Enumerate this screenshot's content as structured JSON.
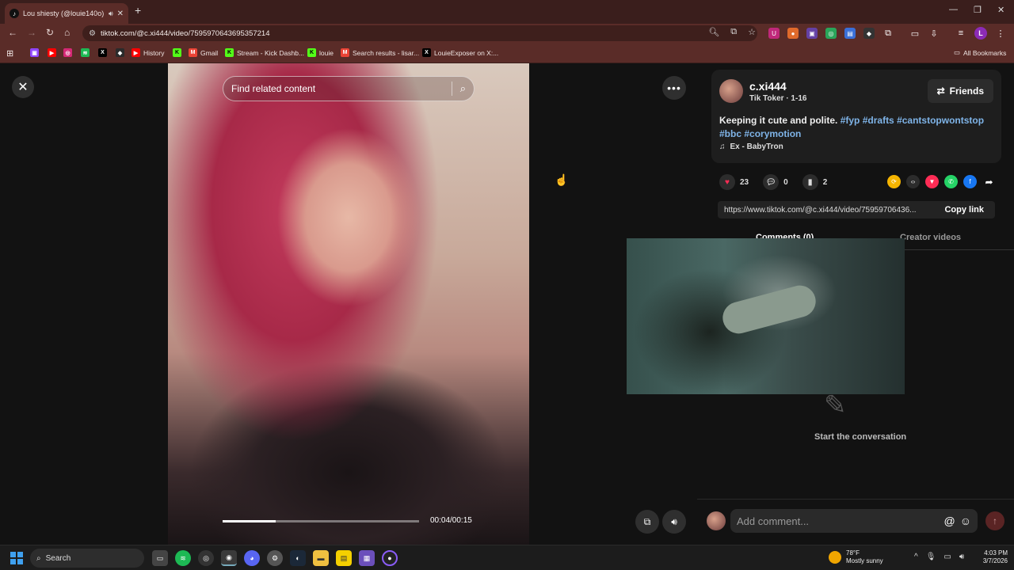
{
  "browser": {
    "tab_title": "Lou shiesty (@louie140o) |",
    "url": "tiktok.com/@c.xi444/video/7595970643695357214",
    "bookmarks": [
      {
        "label": "",
        "icon": "twitch-icon",
        "color": "#9146ff"
      },
      {
        "label": "",
        "icon": "youtube-icon",
        "color": "#ff0000"
      },
      {
        "label": "",
        "icon": "instagram-icon",
        "color": "#d62976"
      },
      {
        "label": "",
        "icon": "spotify-icon",
        "color": "#1db954"
      },
      {
        "label": "",
        "icon": "x-icon",
        "color": "#000000"
      },
      {
        "label": "",
        "icon": "app-icon",
        "color": "#2b2b2b"
      },
      {
        "label": "History",
        "icon": "youtube-icon",
        "color": "#ff0000"
      },
      {
        "label": "",
        "icon": "kick-icon",
        "color": "#53fc18"
      },
      {
        "label": "Gmail",
        "icon": "gmail-icon",
        "color": "#ea4335"
      },
      {
        "label": "Stream - Kick Dashb...",
        "icon": "kick-icon",
        "color": "#53fc18"
      },
      {
        "label": "louie",
        "icon": "kick-icon",
        "color": "#53fc18"
      },
      {
        "label": "Search results - lisar...",
        "icon": "gmail-icon",
        "color": "#ea4335"
      },
      {
        "label": "LouieExposer on X:...",
        "icon": "x-icon",
        "color": "#000000"
      }
    ],
    "all_bookmarks": "All Bookmarks"
  },
  "video": {
    "search_placeholder": "Find related content",
    "time": "00:04/00:15",
    "progress": 0.27
  },
  "post": {
    "username": "c.xi444",
    "subtitle": "Tik Toker · 1-16",
    "friends_label": "Friends",
    "caption_text": "Keeping it cute and polite. ",
    "hashtags": [
      "#fyp",
      "#drafts",
      "#cantstopwontstop",
      "#bbc",
      "#corymotion"
    ],
    "music": "Ex - BabyTron",
    "likes": "23",
    "comments": "0",
    "saves": "2",
    "link": "https://www.tiktok.com/@c.xi444/video/75959706436...",
    "copy_link": "Copy link",
    "tab_comments": "Comments (0)",
    "tab_creator": "Creator videos",
    "empty_text": "Start the conversation",
    "comment_placeholder": "Add comment..."
  },
  "taskbar": {
    "search": "Search",
    "temp": "78°F",
    "weather": "Mostly sunny",
    "time": "4:03 PM",
    "date": "3/7/2026"
  }
}
